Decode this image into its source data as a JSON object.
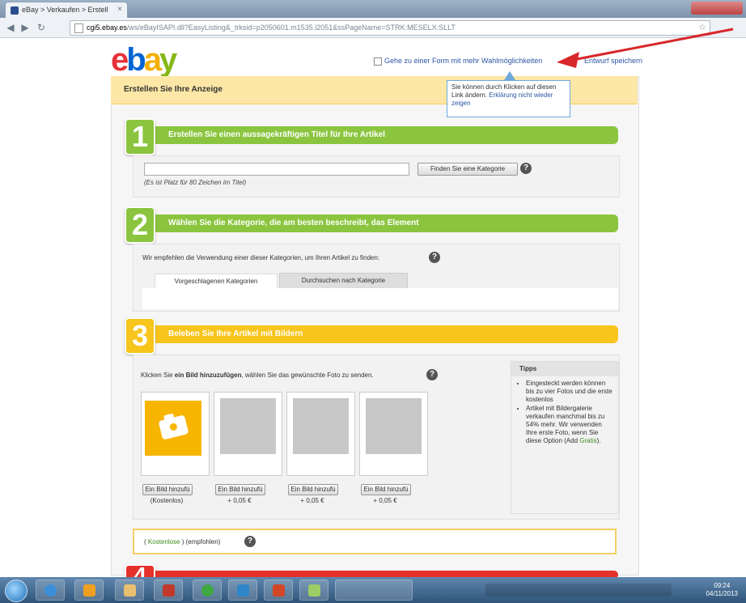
{
  "browser": {
    "tab_title": "eBay > Verkaufen > Erstell",
    "tab_close": "×",
    "url_host": "cgi5.ebay.es",
    "url_path": "/ws/eBayISAPI.dll?EasyListing&_trksid=p2050601.m1535.l2051&ssPageName=STRK:MESELX:SLLT"
  },
  "logo": {
    "e": "e",
    "b": "b",
    "a": "a",
    "y": "y"
  },
  "header": {
    "switch_link": "Gehe zu einer Form mit mehr Wahlmöglichkeiten",
    "save_draft": "Entwurf speichern"
  },
  "tooltip": {
    "text": "Sie können durch Klicken auf diesen Link ändern.",
    "dismiss_link": "Erklärung nicht wieder zeigen"
  },
  "card": {
    "title": "Erstellen Sie Ihre Anzeige"
  },
  "step1": {
    "number": "1",
    "banner": "Erstellen Sie einen aussagekräftigen Titel für Ihre Artikel",
    "title_value": "",
    "find_button": "Finden Sie eine Kategorie",
    "help": "?",
    "note": "(Es ist Platz für 80 Zeichen im Titel)"
  },
  "step2": {
    "number": "2",
    "banner": "Wählen Sie die Kategorie, die am besten beschreibt, das Element",
    "intro": "Wir empfehlen die Verwendung einer dieser Kategorien, um Ihren Artikel zu finden:",
    "help": "?",
    "tabs": [
      "Vorgeschlagenen Kategorien",
      "Durchsuchen nach Kategorie"
    ]
  },
  "step3": {
    "number": "3",
    "banner": "Beleben Sie Ihre Artikel mit Bildern",
    "intro_pre": "Klicken Sie ",
    "intro_bold": "ein Bild hinzuzufügen",
    "intro_post": ", wählen Sie das gewünschte Foto zu senden.",
    "help": "?",
    "slots": [
      {
        "button": "Ein Bild hinzufü",
        "price": "(Kostenlos)"
      },
      {
        "button": "Ein Bild hinzufü",
        "price": "+ 0,05 €"
      },
      {
        "button": "Ein Bild hinzufü",
        "price": "+ 0,05 €"
      },
      {
        "button": "Ein Bild hinzufü",
        "price": "+ 0,05 €"
      }
    ],
    "tips_title": "Tipps",
    "tips": [
      "Eingesteckt werden können bis zu vier Fotos und die erste kostenlos",
      "Artikel mit Bildergalerie verkaufen manchmal bis zu 54% mehr. Wir verwenden Ihre erste Foto, wenn Sie diese Option (Add "
    ],
    "tips_gratis": "Gratis",
    "tips_close": ").",
    "cover_link": "Kostenlose",
    "cover_text": "(empfohlen)",
    "cover_help": "?"
  },
  "step4": {
    "number": "4"
  },
  "taskbar": {
    "time": "09:24",
    "date": "04/11/2013"
  }
}
